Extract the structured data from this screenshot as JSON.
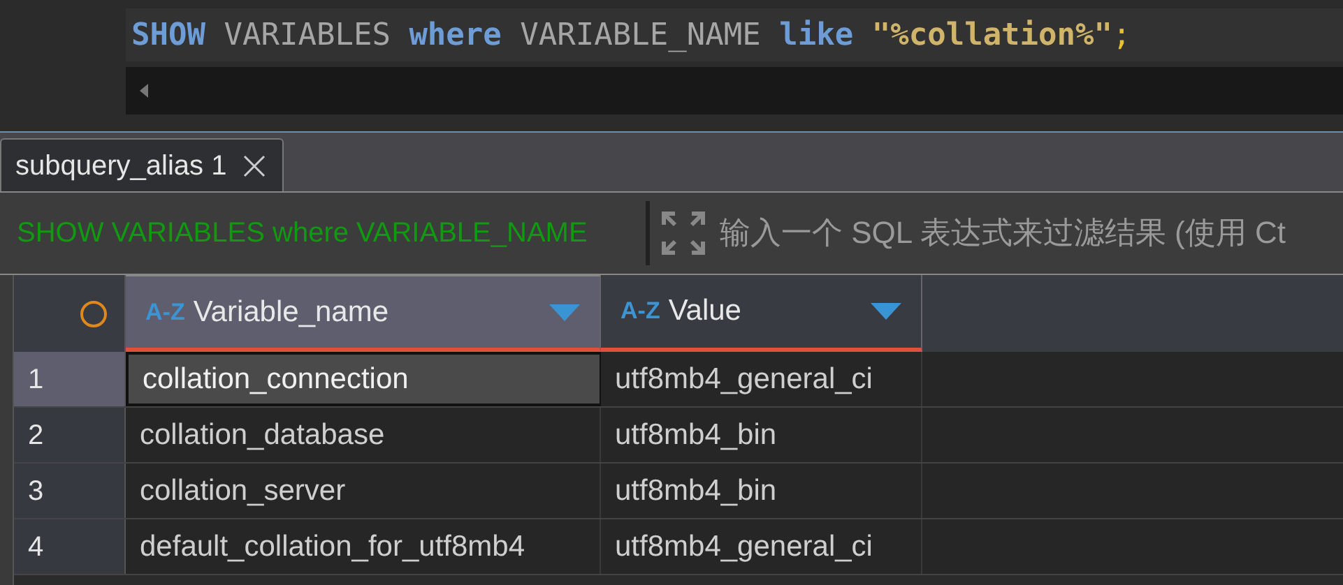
{
  "editor": {
    "code": [
      {
        "kind": "keyword",
        "text": "SHOW"
      },
      {
        "kind": "plain",
        "text": " VARIABLES "
      },
      {
        "kind": "keyword",
        "text": "where"
      },
      {
        "kind": "plain",
        "text": " VARIABLE_NAME "
      },
      {
        "kind": "keyword",
        "text": "like "
      },
      {
        "kind": "string",
        "text": "\"%collation%\""
      },
      {
        "kind": "punct",
        "text": ";"
      }
    ]
  },
  "tabs": [
    {
      "label": "subquery_alias 1",
      "selected": true
    }
  ],
  "filter_bar": {
    "query": "SHOW VARIABLES where VARIABLE_NAME",
    "placeholder": "输入一个 SQL 表达式来过滤结果 (使用 Ct"
  },
  "table": {
    "columns": [
      {
        "sort_label": "A-Z",
        "label": "Variable_name",
        "selected": true
      },
      {
        "sort_label": "A-Z",
        "label": "Value",
        "selected": false
      }
    ],
    "rows": [
      {
        "number": "1",
        "selected": true,
        "cells": [
          "collation_connection",
          "utf8mb4_general_ci"
        ]
      },
      {
        "number": "2",
        "selected": false,
        "cells": [
          "collation_database",
          "utf8mb4_bin"
        ]
      },
      {
        "number": "3",
        "selected": false,
        "cells": [
          "collation_server",
          "utf8mb4_bin"
        ]
      },
      {
        "number": "4",
        "selected": false,
        "cells": [
          "default_collation_for_utf8mb4",
          "utf8mb4_general_ci"
        ]
      }
    ]
  }
}
